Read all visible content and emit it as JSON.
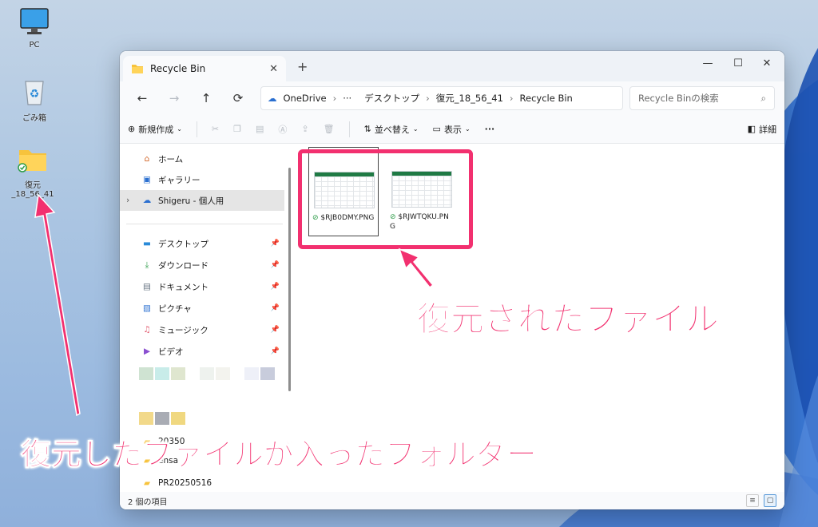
{
  "desktop": {
    "icons": [
      {
        "label": "PC"
      },
      {
        "label": "ごみ箱"
      },
      {
        "label": "復元_18_56_41"
      }
    ]
  },
  "window": {
    "tab_title": "Recycle Bin",
    "nav": {
      "back": "←",
      "forward": "→",
      "up": "↑",
      "refresh": "⟳"
    },
    "address": {
      "crumbs": [
        "OneDrive",
        "···",
        "デスクトップ",
        "復元_18_56_41",
        "Recycle Bin"
      ]
    },
    "search": {
      "placeholder": "Recycle Binの検索"
    },
    "toolbar": {
      "new_label": "新規作成",
      "sort_label": "並べ替え",
      "view_label": "表示",
      "more_label": "···",
      "details_label": "詳細"
    },
    "sidebar": {
      "home": "ホーム",
      "gallery": "ギャラリー",
      "onedrive": "Shigeru - 個人用",
      "desktop": "デスクトップ",
      "downloads": "ダウンロード",
      "documents": "ドキュメント",
      "pictures": "ピクチャ",
      "music": "ミュージック",
      "videos": "ビデオ",
      "partial_1": "20350",
      "partial_2": "ensa",
      "folder_last": "PR20250516"
    },
    "files": [
      {
        "name": "$RJB0DMY.PNG"
      },
      {
        "name": "$RJWTQKU.PNG"
      }
    ],
    "status": {
      "item_count": "2 個の項目"
    }
  },
  "annotations": {
    "restored_files": "復元されたファイル",
    "restored_folder": "復元したファイルが入ったフォルダー",
    "accent": "#f2306f"
  }
}
